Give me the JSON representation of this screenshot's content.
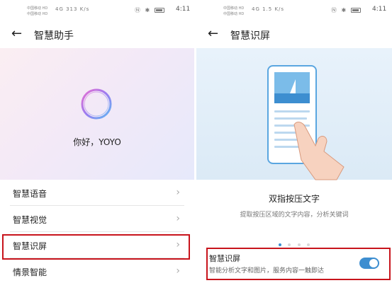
{
  "left": {
    "status": {
      "carrier_line1": "中国移动 HD",
      "carrier_line2": "中国移动 HD",
      "network": "4G 313 K/s",
      "time": "4:11"
    },
    "header": {
      "back_icon": "arrow-left-icon",
      "title": "智慧助手"
    },
    "hero": {
      "greeting": "你好，YOYO"
    },
    "list": [
      {
        "label": "智慧语音"
      },
      {
        "label": "智慧视觉"
      },
      {
        "label": "智慧识屏"
      },
      {
        "label": "情景智能"
      }
    ]
  },
  "right": {
    "status": {
      "carrier_line1": "中国移动 HD",
      "carrier_line2": "中国移动 HD",
      "network": "4G 1.5 K/s",
      "time": "4:11"
    },
    "header": {
      "back_icon": "arrow-left-icon",
      "title": "智慧识屏"
    },
    "feature": {
      "title": "双指按压文字",
      "description": "提取按压区域的文字内容，分析关键词"
    },
    "pager": {
      "count": 4,
      "active": 1
    },
    "setting": {
      "title": "智慧识屏",
      "description": "智能分析文字和图片，服务内容一触即达",
      "enabled": true
    }
  },
  "colors": {
    "accent": "#3d8ed0",
    "highlight": "#c8141c"
  }
}
